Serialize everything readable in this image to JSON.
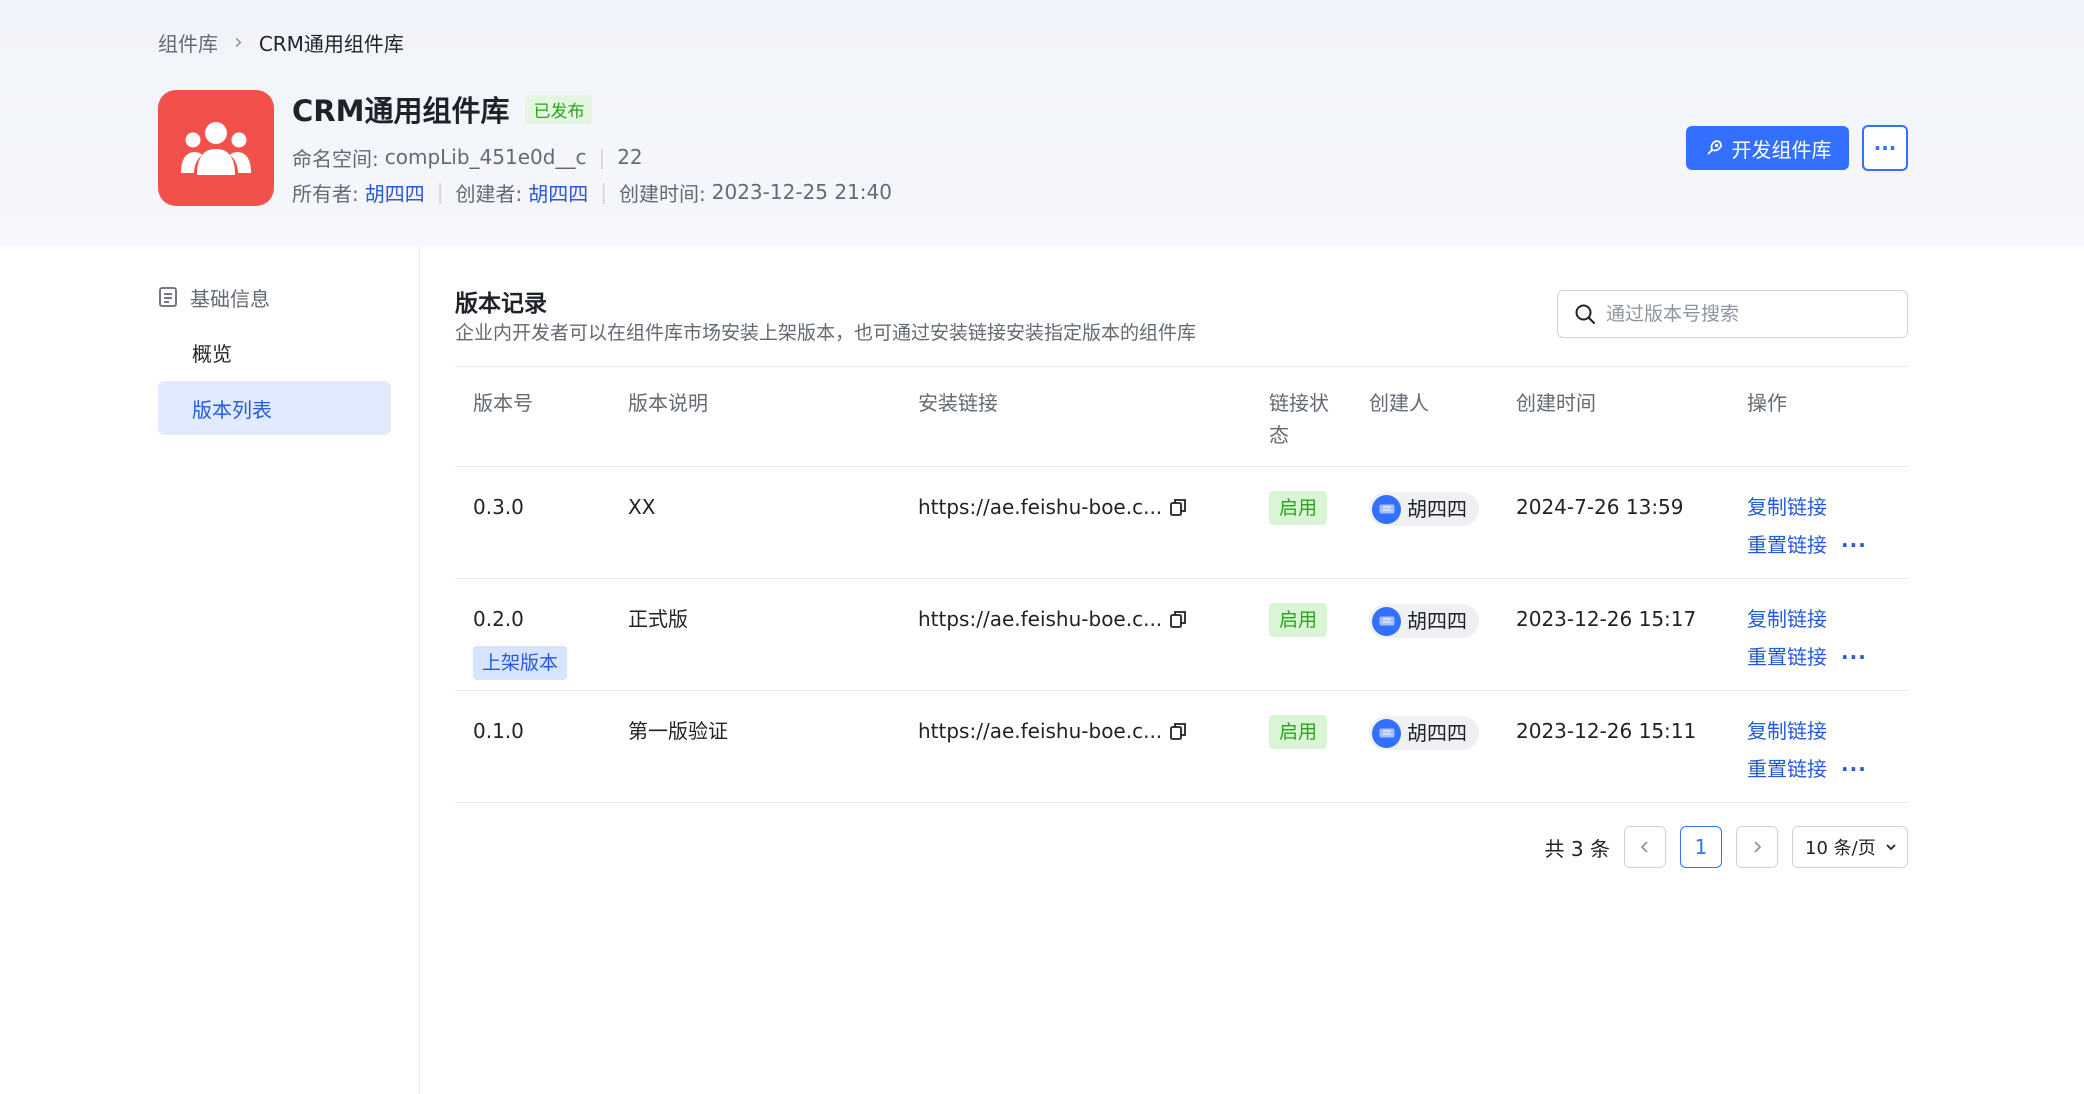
{
  "breadcrumb": {
    "root": "组件库",
    "current": "CRM通用组件库"
  },
  "library": {
    "name": "CRM通用组件库",
    "status": "已发布",
    "namespace_label": "命名空间:",
    "namespace": "compLib_451e0d__c",
    "count": "22",
    "owner_label": "所有者:",
    "owner": "胡四四",
    "creator_label": "创建者:",
    "creator": "胡四四",
    "created_label": "创建时间:",
    "created_at": "2023-12-25 21:40"
  },
  "actions": {
    "develop": "开发组件库",
    "more": "···"
  },
  "sidebar": {
    "group": "基础信息",
    "items": [
      {
        "label": "概览"
      },
      {
        "label": "版本列表"
      }
    ]
  },
  "section": {
    "title": "版本记录",
    "desc": "企业内开发者可以在组件库市场安装上架版本，也可通过安装链接安装指定版本的组件库"
  },
  "search": {
    "placeholder": "通过版本号搜索"
  },
  "table": {
    "headers": [
      "版本号",
      "版本说明",
      "安装链接",
      "链接状态",
      "创建人",
      "创建时间",
      "操作"
    ],
    "rows": [
      {
        "version": "0.3.0",
        "desc": "XX",
        "link": "https://ae.feishu-boe.c...",
        "status": "启用",
        "creator": "胡四四",
        "created": "2024-7-26 13:59",
        "copy": "复制链接",
        "reset": "重置链接",
        "more": "···"
      },
      {
        "version": "0.2.0",
        "tag": "上架版本",
        "desc": "正式版",
        "link": "https://ae.feishu-boe.c...",
        "status": "启用",
        "creator": "胡四四",
        "created": "2023-12-26 15:17",
        "copy": "复制链接",
        "reset": "重置链接",
        "more": "···"
      },
      {
        "version": "0.1.0",
        "desc": "第一版验证",
        "link": "https://ae.feishu-boe.c...",
        "status": "启用",
        "creator": "胡四四",
        "created": "2023-12-26 15:11",
        "copy": "复制链接",
        "reset": "重置链接",
        "more": "···"
      }
    ]
  },
  "pagination": {
    "total": "共 3 条",
    "current_page": "1",
    "page_size": "10 条/页"
  },
  "colors": {
    "primary": "#3370ff",
    "logo": "#f2514b",
    "success": "#2ea121"
  }
}
